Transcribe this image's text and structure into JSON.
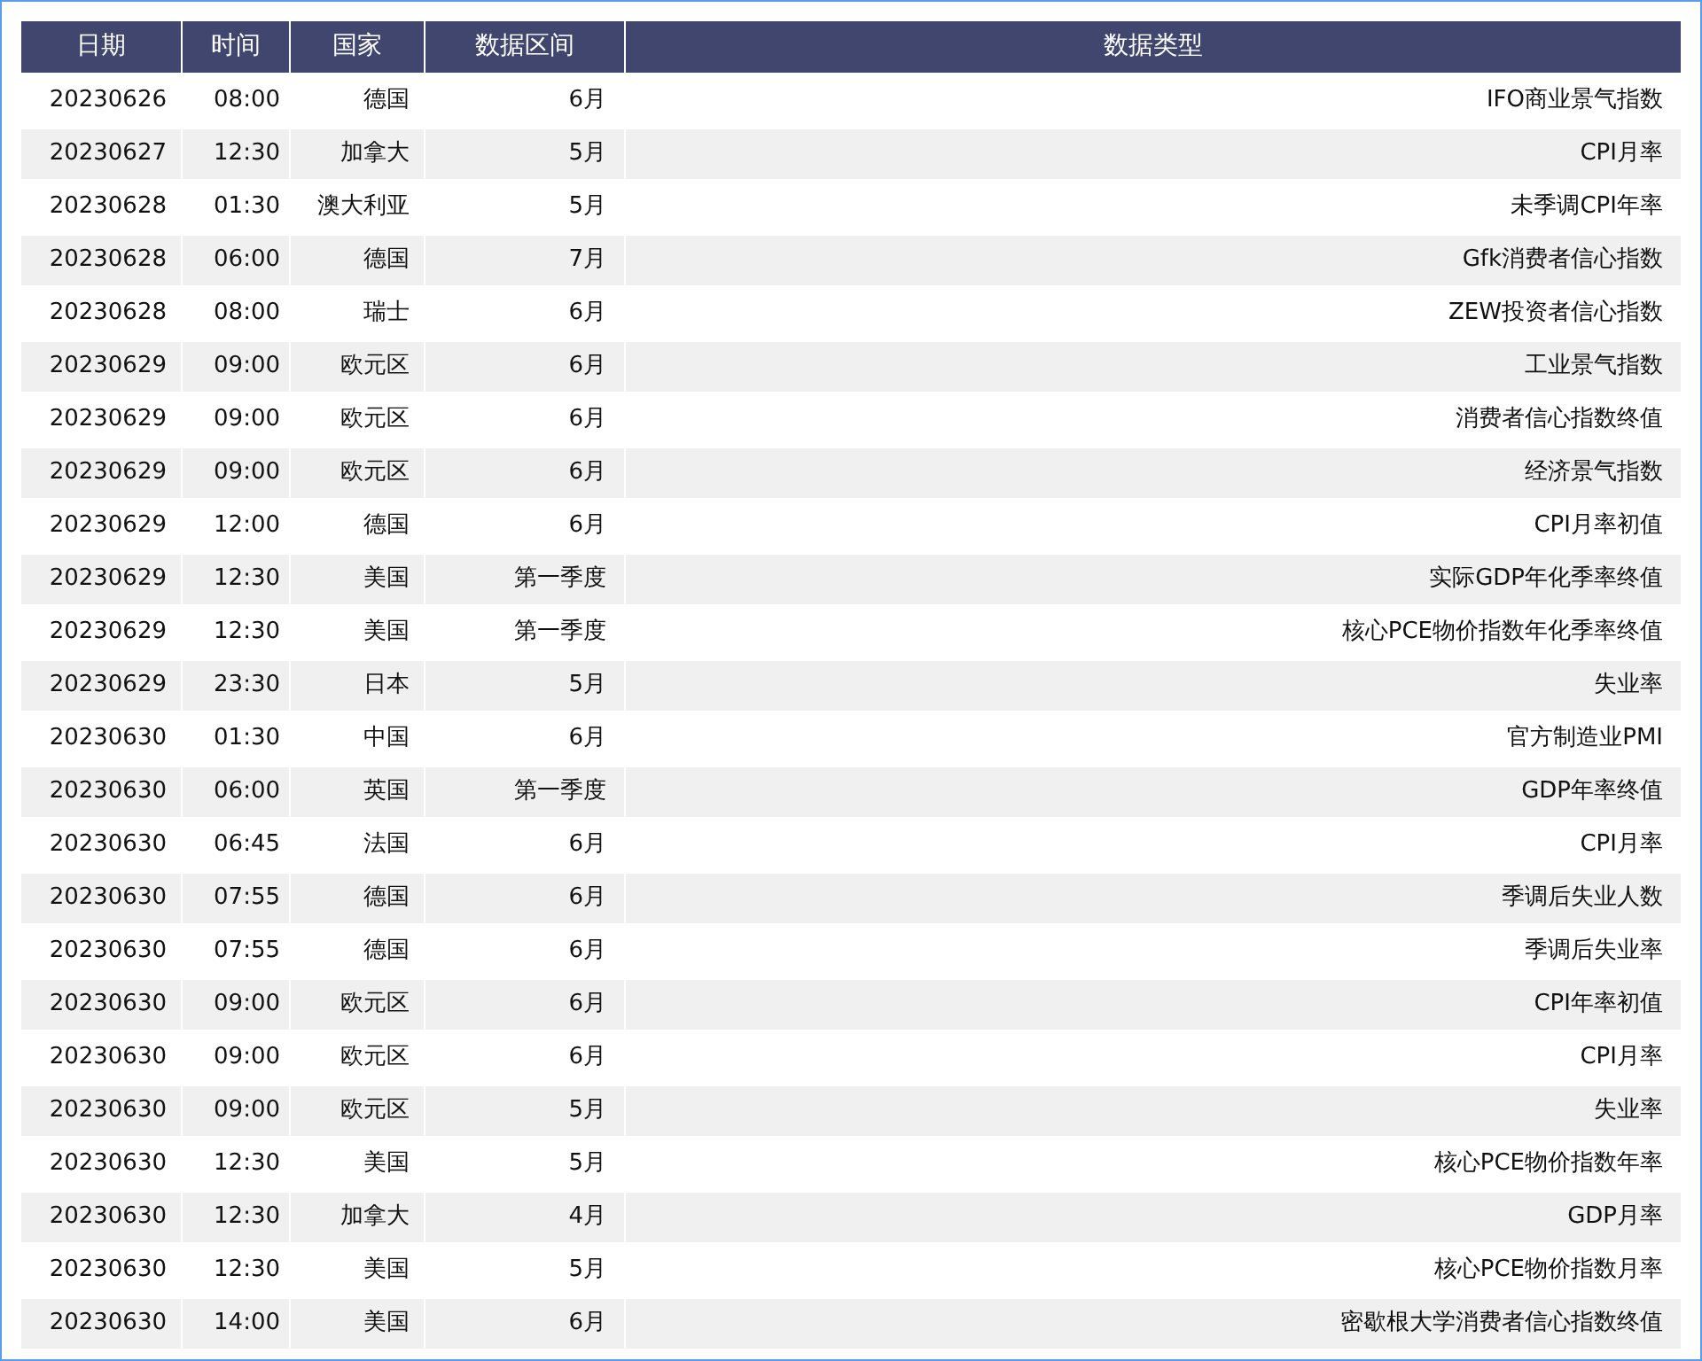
{
  "table": {
    "columns": [
      "日期",
      "时间",
      "国家",
      "数据区间",
      "数据类型"
    ],
    "rows": [
      [
        "20230626",
        "08:00",
        "德国",
        "6月",
        "IFO商业景气指数"
      ],
      [
        "20230627",
        "12:30",
        "加拿大",
        "5月",
        "CPI月率"
      ],
      [
        "20230628",
        "01:30",
        "澳大利亚",
        "5月",
        "未季调CPI年率"
      ],
      [
        "20230628",
        "06:00",
        "德国",
        "7月",
        "Gfk消费者信心指数"
      ],
      [
        "20230628",
        "08:00",
        "瑞士",
        "6月",
        "ZEW投资者信心指数"
      ],
      [
        "20230629",
        "09:00",
        "欧元区",
        "6月",
        "工业景气指数"
      ],
      [
        "20230629",
        "09:00",
        "欧元区",
        "6月",
        "消费者信心指数终值"
      ],
      [
        "20230629",
        "09:00",
        "欧元区",
        "6月",
        "经济景气指数"
      ],
      [
        "20230629",
        "12:00",
        "德国",
        "6月",
        "CPI月率初值"
      ],
      [
        "20230629",
        "12:30",
        "美国",
        "第一季度",
        "实际GDP年化季率终值"
      ],
      [
        "20230629",
        "12:30",
        "美国",
        "第一季度",
        "核心PCE物价指数年化季率终值"
      ],
      [
        "20230629",
        "23:30",
        "日本",
        "5月",
        "失业率"
      ],
      [
        "20230630",
        "01:30",
        "中国",
        "6月",
        "官方制造业PMI"
      ],
      [
        "20230630",
        "06:00",
        "英国",
        "第一季度",
        "GDP年率终值"
      ],
      [
        "20230630",
        "06:45",
        "法国",
        "6月",
        "CPI月率"
      ],
      [
        "20230630",
        "07:55",
        "德国",
        "6月",
        "季调后失业人数"
      ],
      [
        "20230630",
        "07:55",
        "德国",
        "6月",
        "季调后失业率"
      ],
      [
        "20230630",
        "09:00",
        "欧元区",
        "6月",
        "CPI年率初值"
      ],
      [
        "20230630",
        "09:00",
        "欧元区",
        "6月",
        "CPI月率"
      ],
      [
        "20230630",
        "09:00",
        "欧元区",
        "5月",
        "失业率"
      ],
      [
        "20230630",
        "12:30",
        "美国",
        "5月",
        "核心PCE物价指数年率"
      ],
      [
        "20230630",
        "12:30",
        "加拿大",
        "4月",
        "GDP月率"
      ],
      [
        "20230630",
        "12:30",
        "美国",
        "5月",
        "核心PCE物价指数月率"
      ],
      [
        "20230630",
        "14:00",
        "美国",
        "6月",
        "密歇根大学消费者信心指数终值"
      ]
    ]
  }
}
